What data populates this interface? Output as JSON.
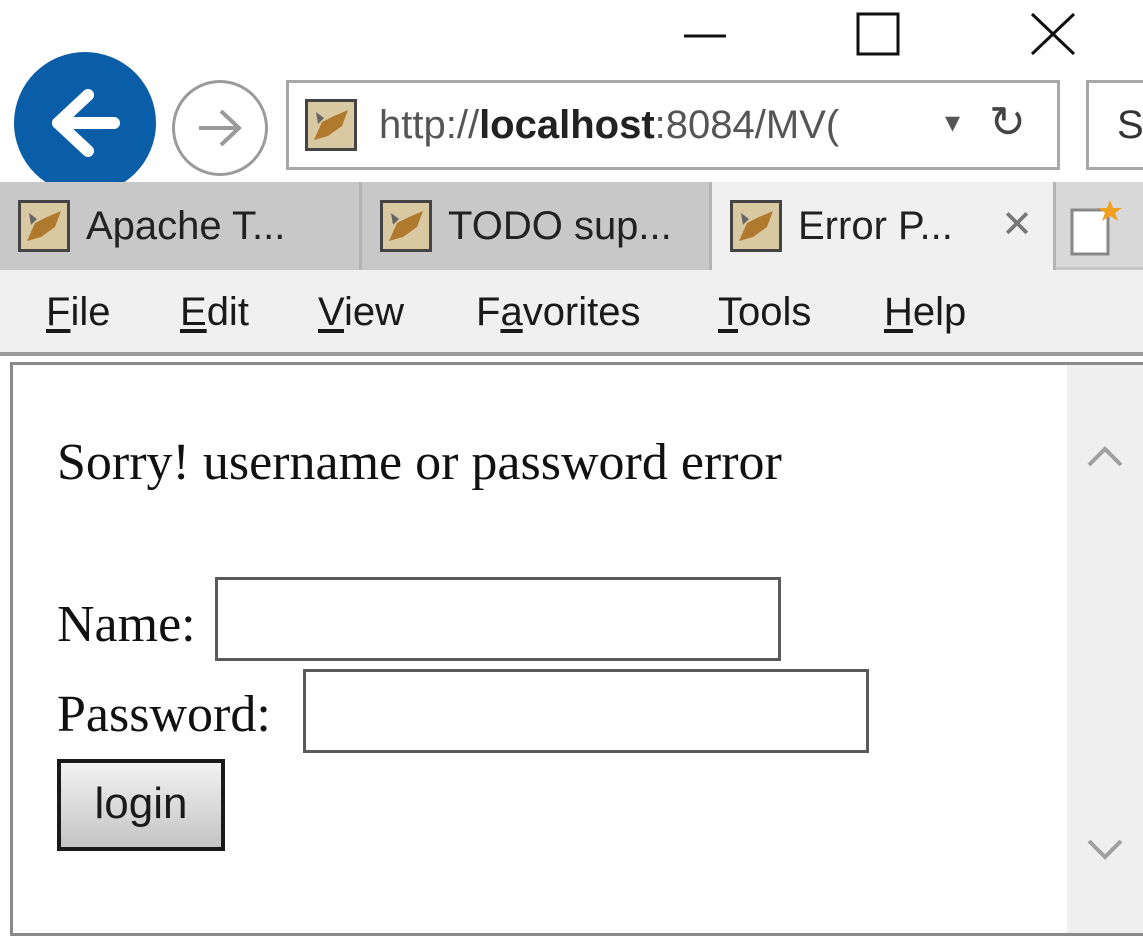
{
  "window": {
    "icons": {
      "minimize": "minimize-icon",
      "maximize": "maximize-icon",
      "close": "close-icon"
    }
  },
  "nav": {
    "back_icon": "back-arrow-icon",
    "forward_icon": "forward-arrow-icon",
    "address": {
      "prefix": "http://",
      "host": "localhost",
      "suffix": ":8084/MV(",
      "dropdown_icon": "▾",
      "refresh_icon": "↻"
    },
    "search_partial": "S"
  },
  "tabs": [
    {
      "label": "Apache T...",
      "active": false
    },
    {
      "label": "TODO sup...",
      "active": false
    },
    {
      "label": "Error P...",
      "active": true,
      "close": "✕"
    }
  ],
  "menu": [
    {
      "access": "F",
      "rest": "ile"
    },
    {
      "access": "E",
      "rest": "dit"
    },
    {
      "access": "V",
      "rest": "iew"
    },
    {
      "pre": "F",
      "access": "a",
      "rest": "vorites"
    },
    {
      "access": "T",
      "rest": "ools"
    },
    {
      "access": "H",
      "rest": "elp"
    }
  ],
  "page": {
    "error_message": "Sorry! username or password error",
    "name_label": "Name:",
    "name_value": "",
    "password_label": "Password:",
    "password_value": "",
    "login_label": "login"
  },
  "colors": {
    "back_button": "#0a5ea8",
    "tab_active": "#f0f0f0",
    "tab_inactive": "#c8c8c8"
  }
}
